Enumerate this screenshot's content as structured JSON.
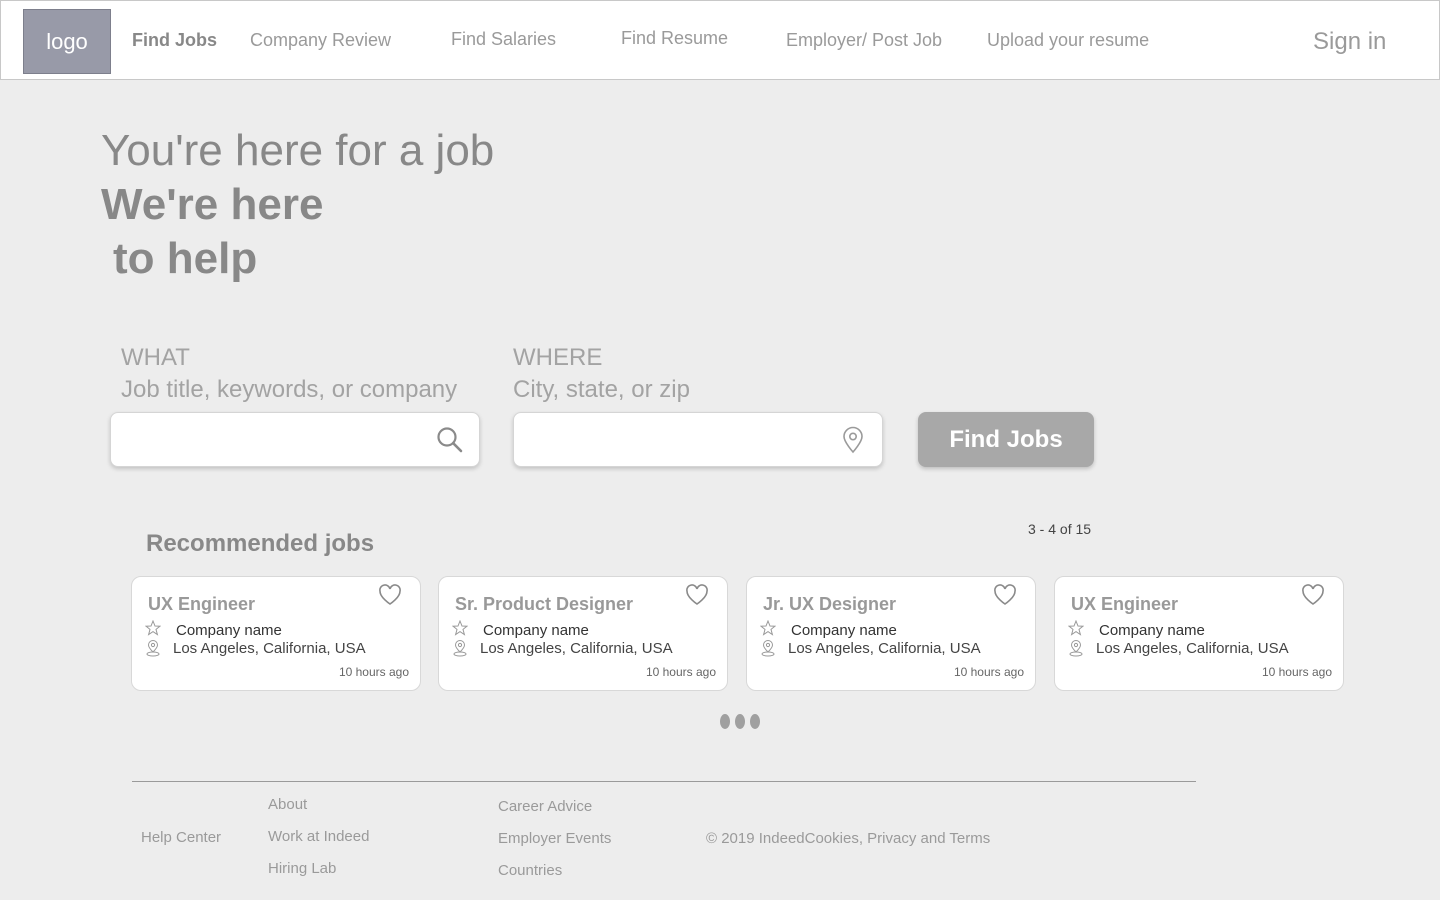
{
  "header": {
    "logo": "logo",
    "nav": [
      "Find Jobs",
      "Company Review",
      "Find Salaries",
      "Find Resume",
      "Employer/ Post Job",
      "Upload your resume"
    ],
    "sign_in": "Sign in"
  },
  "hero": {
    "line1": "You're here for a job",
    "line2": "We're here",
    "line3": "to help"
  },
  "search": {
    "what_label": "WHAT",
    "what_hint": "Job title, keywords, or company",
    "where_label": "WHERE",
    "where_hint": "City, state, or zip",
    "what_value": "",
    "where_value": "",
    "button": "Find Jobs"
  },
  "recommended": {
    "title": "Recommended jobs",
    "pager": "3 - 4 of 15",
    "jobs": [
      {
        "title": "UX Engineer",
        "company": "Company name",
        "location": "Los Angeles, California, USA",
        "time": "10 hours ago"
      },
      {
        "title": "Sr. Product Designer",
        "company": "Company name",
        "location": "Los Angeles, California, USA",
        "time": "10 hours ago"
      },
      {
        "title": "Jr. UX Designer",
        "company": "Company name",
        "location": "Los Angeles, California, USA",
        "time": "10 hours ago"
      },
      {
        "title": "UX Engineer",
        "company": "Company name",
        "location": "Los Angeles, California, USA",
        "time": "10 hours ago"
      }
    ]
  },
  "footer": {
    "help_center": "Help Center",
    "col1": [
      "About",
      "Work at Indeed",
      "Hiring Lab"
    ],
    "col2": [
      "Career Advice",
      "Employer Events",
      "Countries"
    ],
    "copyright": "© 2019 IndeedCookies, Privacy and Terms"
  },
  "icons": {
    "search": "search-icon",
    "location": "location-pin-icon",
    "favorite": "heart-icon",
    "rating": "star-icon",
    "pagination": "more-dots-icon"
  },
  "colors": {
    "background": "#ededed",
    "header": "#ffffff",
    "logo": "#989aa8",
    "button": "#a8a8a8"
  }
}
